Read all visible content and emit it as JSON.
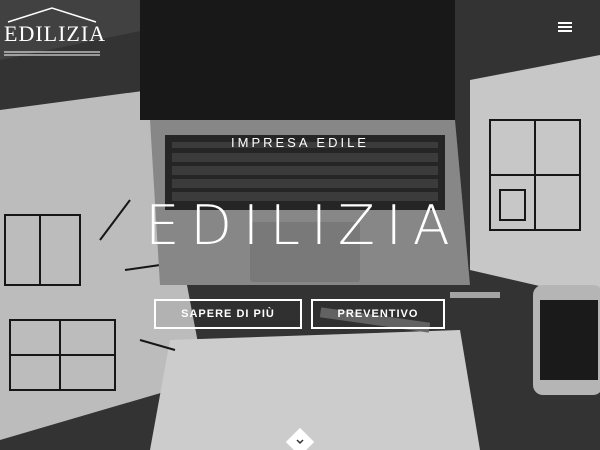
{
  "brand": {
    "name": "EDILIZIA"
  },
  "hero": {
    "kicker": "IMPRESA EDILE",
    "title": "EDILIZIA",
    "cta_primary": "SAPERE DI PIÙ",
    "cta_secondary": "PREVENTIVO"
  },
  "icons": {
    "menu": "hamburger-menu-icon",
    "scroll": "chevron-down-icon",
    "logo_roof": "house-roof-icon"
  },
  "colors": {
    "text": "#ffffff",
    "desk": "#3b3b3b",
    "paper": "#e6e6e6",
    "laptop": "#2a2a2a"
  }
}
